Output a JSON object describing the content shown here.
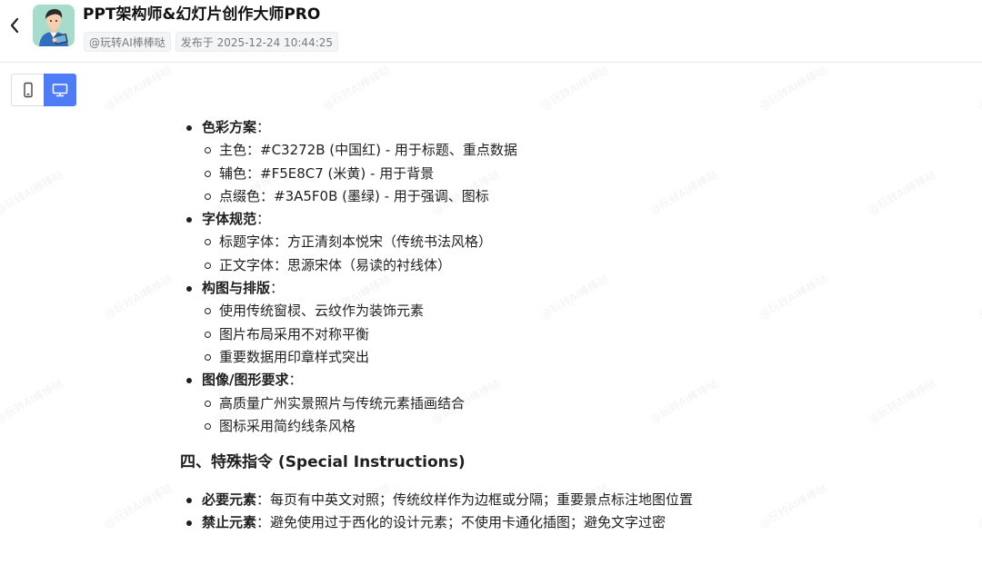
{
  "header": {
    "back_icon": "chevron-left-icon",
    "avatar_icon": "user-avatar-icon",
    "title": "PPT架构师&幻灯片创作大师PRO",
    "author": "@玩转AI棒棒哒",
    "published": "发布于 2025-12-24 10:44:25"
  },
  "device_toggle": {
    "mobile_icon": "mobile-phone-icon",
    "desktop_icon": "desktop-monitor-icon",
    "active": "desktop",
    "active_color": "#4e7cf6"
  },
  "content": {
    "sections": [
      {
        "label": "色彩方案",
        "items": [
          "主色：#C3272B (中国红) - 用于标题、重点数据",
          "辅色：#F5E8C7 (米黄) - 用于背景",
          "点缀色：#3A5F0B (墨绿) - 用于强调、图标"
        ]
      },
      {
        "label": "字体规范",
        "items": [
          "标题字体：方正清刻本悦宋（传统书法风格）",
          "正文字体：思源宋体（易读的衬线体）"
        ]
      },
      {
        "label": "构图与排版",
        "items": [
          "使用传统窗棂、云纹作为装饰元素",
          "图片布局采用不对称平衡",
          "重要数据用印章样式突出"
        ]
      },
      {
        "label": "图像/图形要求",
        "items": [
          "高质量广州实景照片与传统元素插画结合",
          "图标采用简约线条风格"
        ]
      }
    ],
    "heading": "四、特殊指令 (Special Instructions)",
    "instructions": [
      {
        "label": "必要元素",
        "text": "每页有中英文对照；传统纹样作为边框或分隔；重要景点标注地图位置"
      },
      {
        "label": "禁止元素",
        "text": "避免使用过于西化的设计元素；不使用卡通化插图；避免文字过密"
      }
    ],
    "colon": "："
  },
  "watermark_text": "@玩转AI棒棒哒"
}
